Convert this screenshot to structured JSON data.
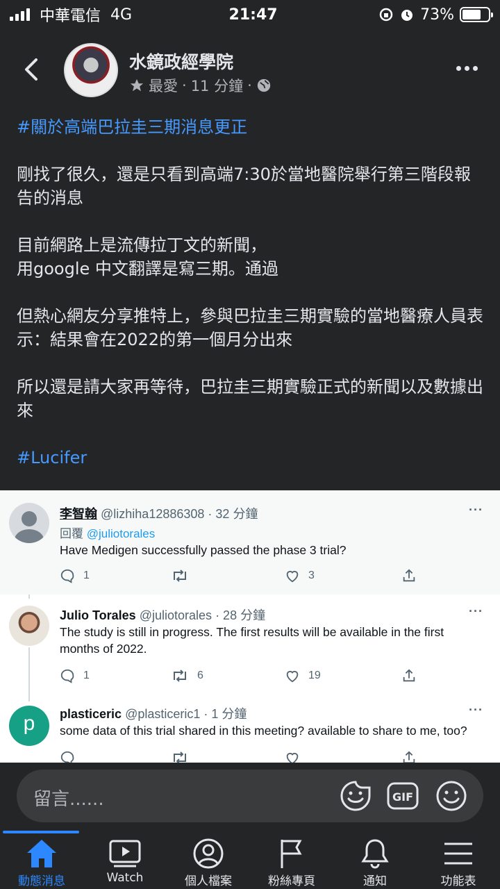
{
  "status_bar": {
    "carrier": "中華電信",
    "network": "4G",
    "time": "21:47",
    "battery_percent": "73%",
    "battery_level": 0.73
  },
  "post": {
    "page_name": "水鏡政經學院",
    "favorite_label": "最愛",
    "time_ago": "11 分鐘",
    "separator": "·",
    "hashtag_title": "#關於高端巴拉圭三期消息更正",
    "paragraphs": [
      "剛找了很久，還是只看到高端7:30於當地醫院舉行第三階段報告的消息",
      "目前網路上是流傳拉丁文的新聞，\n用google 中文翻譯是寫三期。通過",
      "但熱心網友分享推特上，參與巴拉圭三期實驗的當地醫療人員表示：結果會在2022的第一個月分出來",
      "所以還是請大家再等待，巴拉圭三期實驗正式的新聞以及數據出來"
    ],
    "hashtag_footer": "#Lucifer"
  },
  "tweets": [
    {
      "name": "李智翰",
      "handle": "@lizhiha12886308",
      "time": "· 32 分鐘",
      "reply_prefix": "回覆",
      "reply_to": "@juliotorales",
      "text": "Have Medigen successfully passed the phase 3 trial?",
      "replies": "1",
      "retweets": "",
      "likes": "3"
    },
    {
      "name": "Julio Torales",
      "handle": "@juliotorales",
      "time": "· 28 分鐘",
      "text": "The study is still in progress. The first results will be available in the first months of 2022.",
      "replies": "1",
      "retweets": "6",
      "likes": "19"
    },
    {
      "name": "plasticeric",
      "handle": "@plasticeric1",
      "time": "· 1 分鐘",
      "avatar_letter": "p",
      "text": "some data of this trial shared in this meeting? available to share to me, too?"
    }
  ],
  "comment_bar": {
    "placeholder": "留言......",
    "gif_label": "GIF"
  },
  "bottom_nav": [
    {
      "label": "動態消息",
      "icon": "home-icon",
      "active": true
    },
    {
      "label": "Watch",
      "icon": "watch-icon"
    },
    {
      "label": "個人檔案",
      "icon": "profile-icon"
    },
    {
      "label": "粉絲專頁",
      "icon": "flag-icon"
    },
    {
      "label": "通知",
      "icon": "bell-icon"
    },
    {
      "label": "功能表",
      "icon": "menu-icon"
    }
  ],
  "colors": {
    "background": "#242526",
    "hashtag": "#4599ff",
    "nav_active": "#2d88ff",
    "tweet_link": "#1d9bf0"
  }
}
